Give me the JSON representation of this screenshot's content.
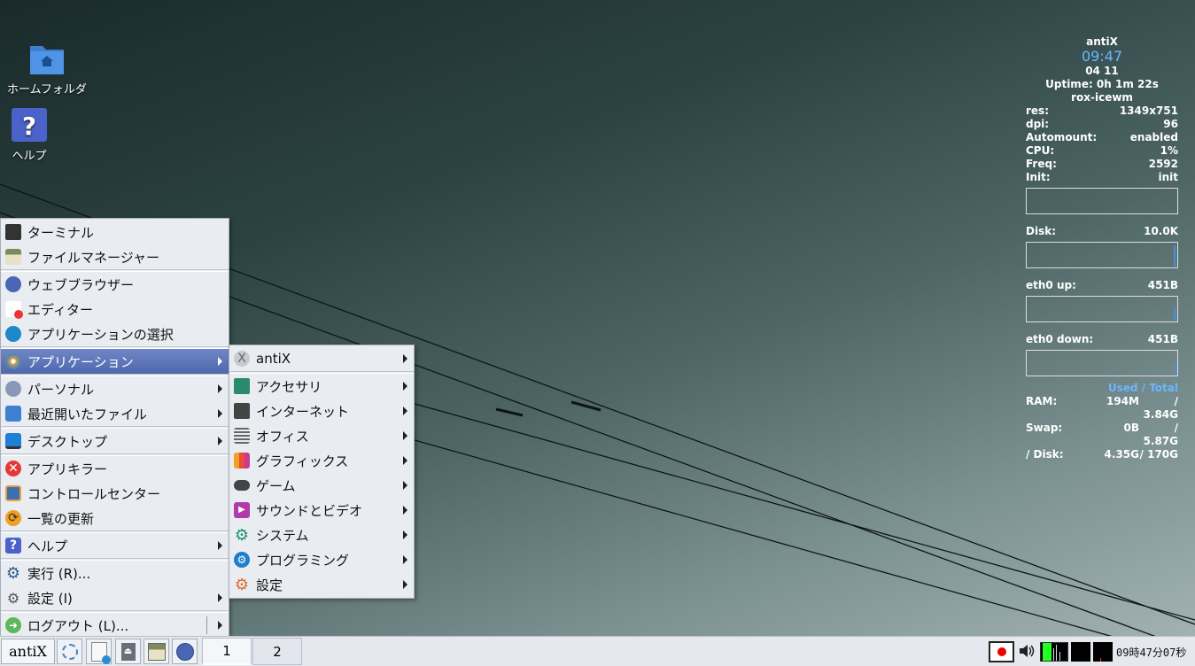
{
  "desktop": {
    "icons": [
      {
        "label": "ホームフォルダ"
      },
      {
        "label": "ヘルプ"
      }
    ]
  },
  "conky": {
    "host": "antiX",
    "time": "09:47",
    "date": " 04 11",
    "uptime": "Uptime: 0h 1m 22s",
    "wm": "rox-icewm",
    "stats": [
      {
        "k": "res:",
        "v": "1349x751"
      },
      {
        "k": "dpi:",
        "v": "96"
      },
      {
        "k": "Automount:",
        "v": "enabled"
      },
      {
        "k": "CPU:",
        "v": "1%"
      },
      {
        "k": "Freq:",
        "v": "2592"
      },
      {
        "k": "Init:",
        "v": "init"
      }
    ],
    "disk": {
      "k": "Disk:",
      "v": "10.0K"
    },
    "eth_up": {
      "k": "eth0 up:",
      "v": "451B"
    },
    "eth_down": {
      "k": "eth0 down:",
      "v": "451B"
    },
    "used_total": "Used / Total",
    "mem": [
      {
        "k": "RAM:",
        "used": "194M",
        "total": "/ 3.84G"
      },
      {
        "k": "Swap:",
        "used": "0B",
        "total": "/ 5.87G"
      },
      {
        "k": "/ Disk:",
        "used": "4.35G",
        "total": "/ 170G"
      }
    ]
  },
  "main_menu": {
    "items": [
      {
        "label": "ターミナル"
      },
      {
        "label": "ファイルマネージャー"
      },
      {
        "label": "ウェブブラウザー"
      },
      {
        "label": "エディター"
      },
      {
        "label": "アプリケーションの選択"
      },
      {
        "label": "アプリケーション"
      },
      {
        "label": "パーソナル"
      },
      {
        "label": "最近開いたファイル"
      },
      {
        "label": "デスクトップ"
      },
      {
        "label": "アプリキラー"
      },
      {
        "label": "コントロールセンター"
      },
      {
        "label": "一覧の更新"
      },
      {
        "label": "ヘルプ"
      },
      {
        "label": "実行 (R)..."
      },
      {
        "label": "設定 (I)"
      },
      {
        "label": "ログアウト (L)..."
      }
    ]
  },
  "apps_menu": {
    "items": [
      {
        "label": "antiX"
      },
      {
        "label": "アクセサリ"
      },
      {
        "label": "インターネット"
      },
      {
        "label": "オフィス"
      },
      {
        "label": "グラフィックス"
      },
      {
        "label": "ゲーム"
      },
      {
        "label": "サウンドとビデオ"
      },
      {
        "label": "システム"
      },
      {
        "label": "プログラミング"
      },
      {
        "label": "設定"
      }
    ]
  },
  "taskbar": {
    "start_label": "antiX",
    "workspaces": [
      "1",
      "2"
    ],
    "clock": "09時47分07秒"
  },
  "colors": {
    "accent": "#5a73b6",
    "conky_blue": "#6cb6ff"
  }
}
